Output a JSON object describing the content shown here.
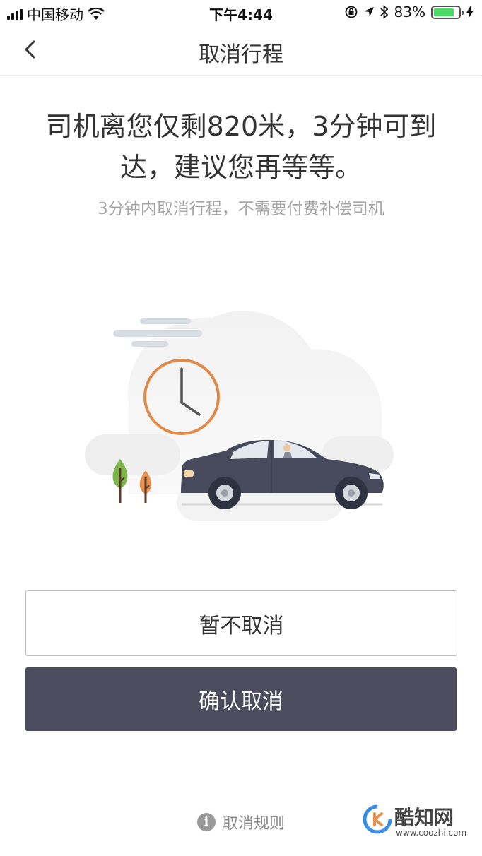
{
  "status_bar": {
    "carrier": "中国移动",
    "time": "下午4:44",
    "battery_percent": "83%",
    "battery_level": 0.83,
    "icons": [
      "signal-icon",
      "wifi-icon",
      "orientation-lock-icon",
      "location-icon",
      "bluetooth-icon",
      "battery-icon",
      "charging-icon"
    ]
  },
  "nav": {
    "back_icon": "chevron-left-icon",
    "title": "取消行程"
  },
  "message": {
    "headline_line1": "司机离您仅剩820米，3分钟可到",
    "headline_line2": "达，建议您再等等。",
    "subtitle": "3分钟内取消行程，不需要付费补偿司机"
  },
  "illustration": {
    "description_icons": [
      "clock-icon",
      "car-icon",
      "tree-icon",
      "cloud-icon"
    ],
    "colors": {
      "clock": "#e08a4a",
      "car": "#464a5c",
      "tree_green": "#7ab648",
      "tree_orange": "#e8904b"
    }
  },
  "actions": {
    "keep_label": "暂不取消",
    "confirm_label": "确认取消",
    "confirm_color": "#4d4c5e"
  },
  "footer": {
    "rules_label": "取消规则",
    "rules_icon": "info-icon"
  },
  "watermark": {
    "name": "酷知网",
    "url": "www.coozhi.com"
  }
}
